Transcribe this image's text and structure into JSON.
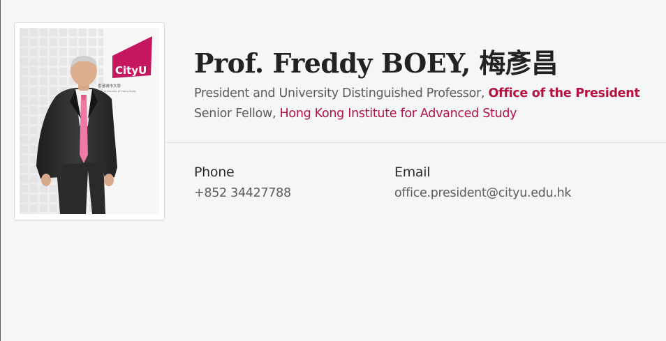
{
  "profile": {
    "name": "Prof. Freddy BOEY, 梅彥昌",
    "roles": [
      {
        "prefix": "President and University Distinguished Professor, ",
        "link_text": "Office of the President"
      },
      {
        "prefix": "Senior Fellow, ",
        "link_text": "Hong Kong Institute for Advanced Study"
      }
    ],
    "photo_sign": {
      "logo_text": "CityU",
      "chinese_text": "香港城市大學",
      "english_text": "City University of Hong Kong"
    }
  },
  "contact": {
    "phone_label": "Phone",
    "phone_value": "+852 34427788",
    "email_label": "Email",
    "email_value": "office.president@cityu.edu.hk"
  },
  "colors": {
    "accent": "#b3123f",
    "background": "#f5f6f8",
    "text_primary": "#222222",
    "text_secondary": "#5c5c5c",
    "brand_magenta": "#c5175f"
  }
}
